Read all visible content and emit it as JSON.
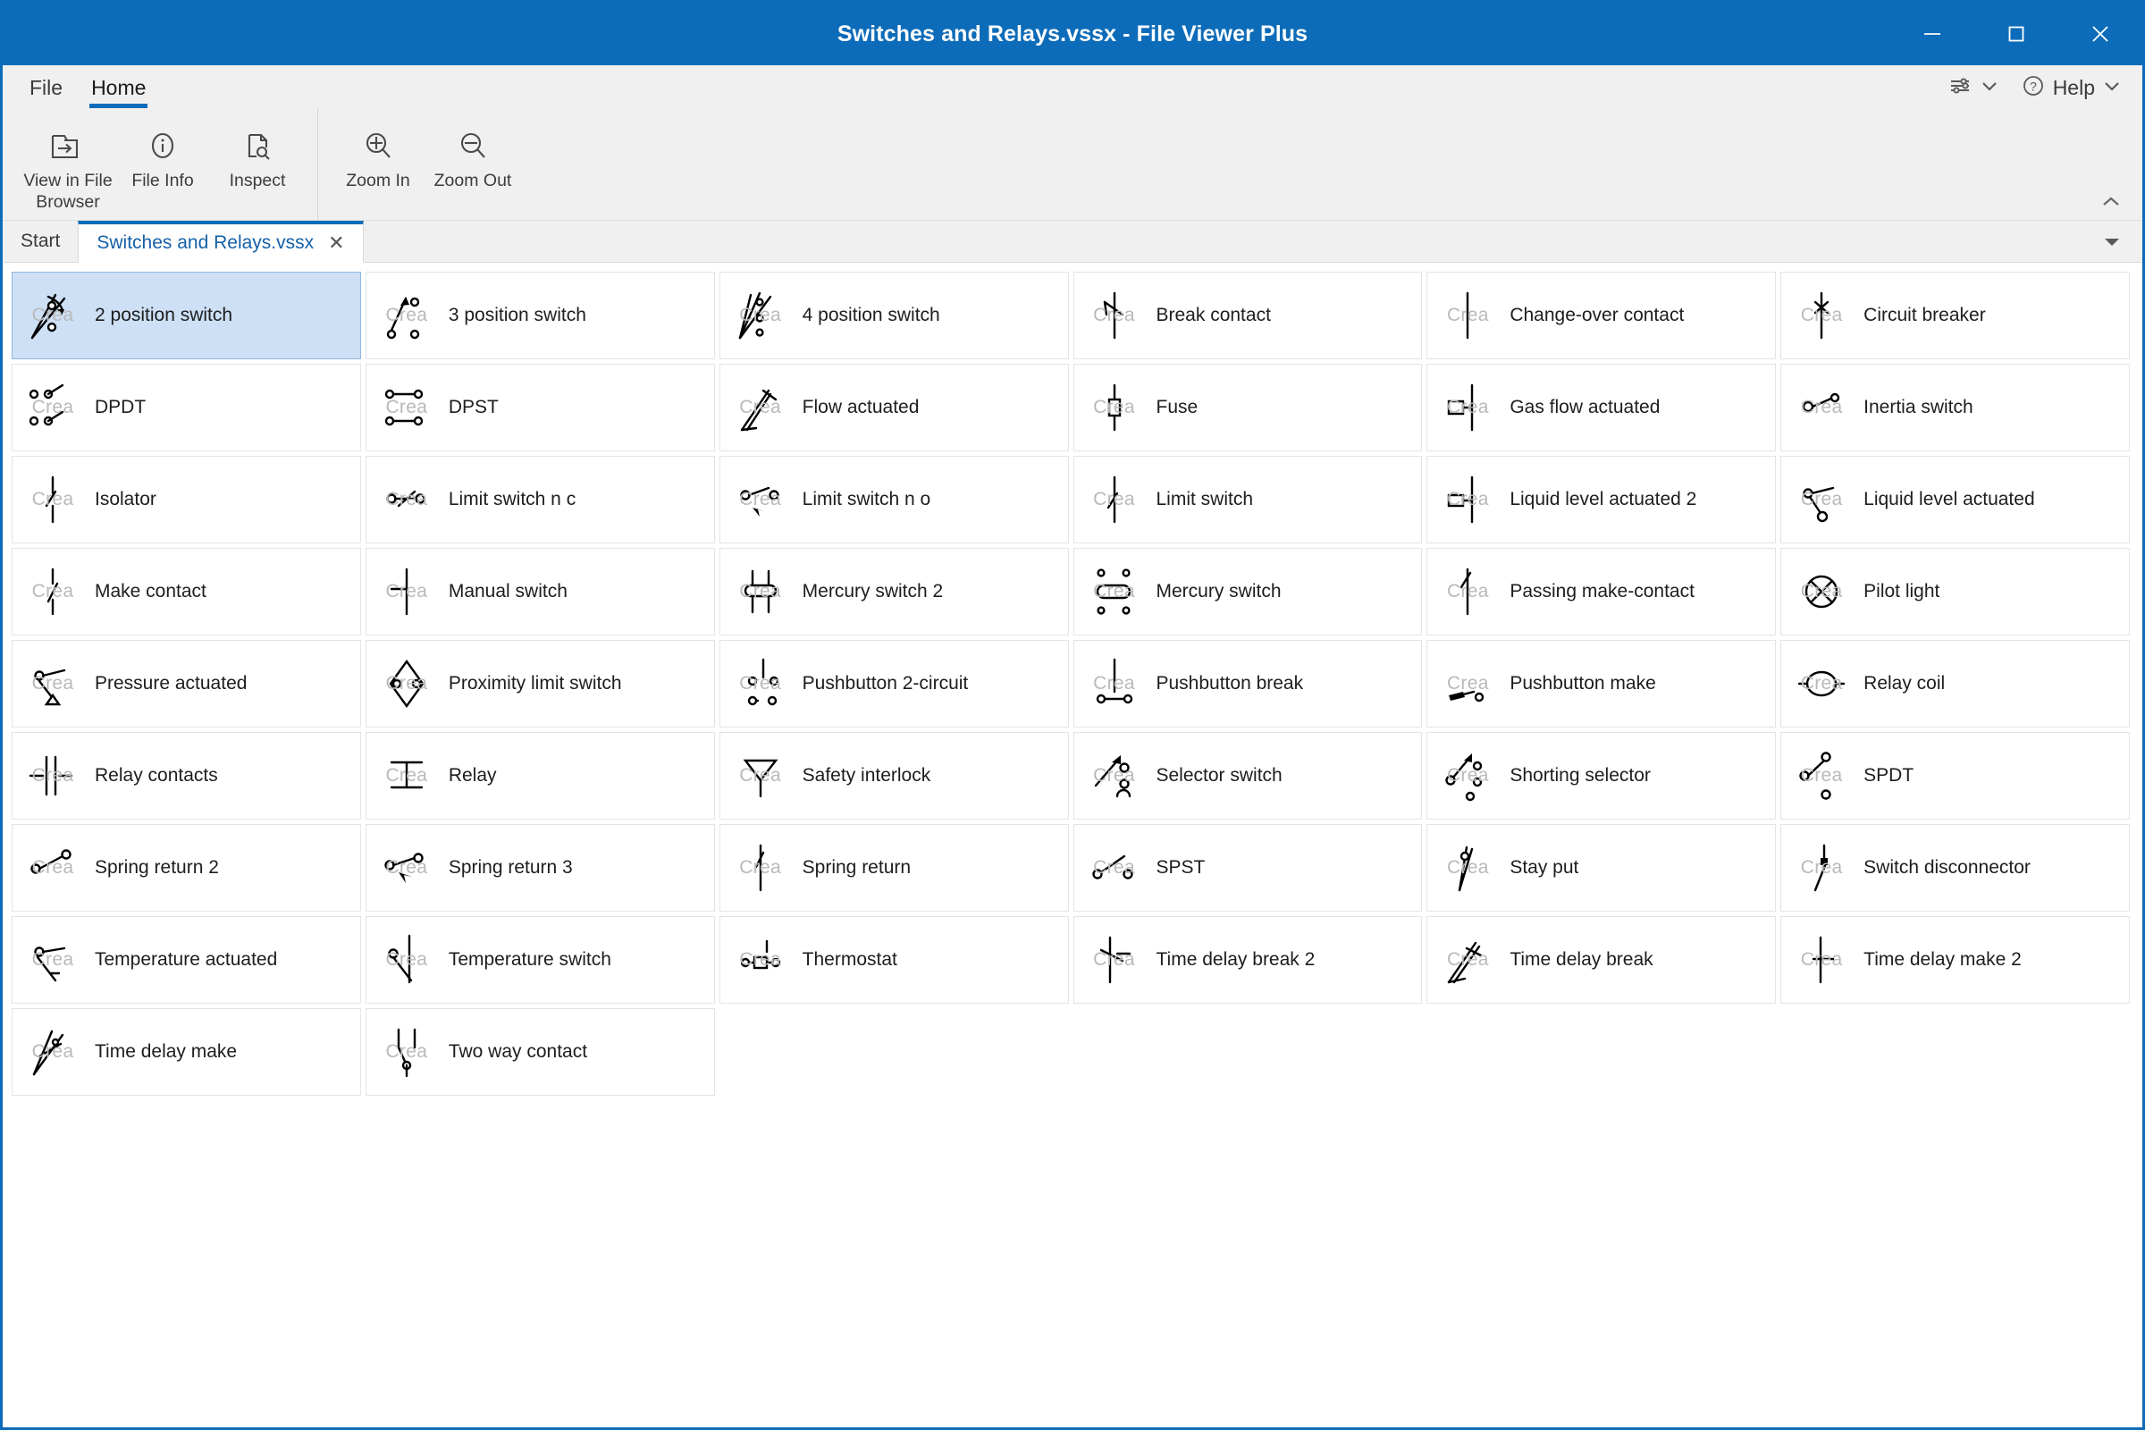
{
  "window": {
    "title": "Switches and Relays.vssx - File Viewer Plus",
    "minimize_label": "minimize",
    "maximize_label": "maximize",
    "close_label": "close",
    "accent_color": "#0d6cb9",
    "titlebar_color": "#0d6cb9",
    "selection_color": "#cde0f5"
  },
  "ribbon": {
    "tabs": [
      {
        "label": "File",
        "active": false
      },
      {
        "label": "Home",
        "active": true
      }
    ],
    "groups": [
      {
        "buttons": [
          {
            "label": "View in File Browser",
            "icon": "open-folder-arrow-icon"
          },
          {
            "label": "File Info",
            "icon": "info-circle-icon"
          },
          {
            "label": "Inspect",
            "icon": "document-magnifier-icon"
          }
        ]
      },
      {
        "buttons": [
          {
            "label": "Zoom In",
            "icon": "zoom-in-icon"
          },
          {
            "label": "Zoom Out",
            "icon": "zoom-out-icon"
          }
        ]
      }
    ],
    "quick_settings": {
      "icon": "sliders-icon",
      "chevron": "chevron-down-icon"
    },
    "help": {
      "label": "Help",
      "icon": "question-circle-icon",
      "chevron": "chevron-down-icon"
    },
    "collapse": {
      "icon": "chevron-up-icon"
    }
  },
  "doc_tabs": {
    "tabs": [
      {
        "label": "Start",
        "active": false,
        "closable": false
      },
      {
        "label": "Switches and Relays.vssx",
        "active": true,
        "closable": true,
        "close_glyph": "✕"
      }
    ],
    "overflow": {
      "icon": "chevron-down-icon"
    }
  },
  "stencil": {
    "watermark": "Crea",
    "items": [
      {
        "label": "2 position switch",
        "shape": "two-position-switch",
        "selected": true
      },
      {
        "label": "3 position switch",
        "shape": "three-position-switch",
        "selected": false
      },
      {
        "label": "4 position switch",
        "shape": "four-position-switch",
        "selected": false
      },
      {
        "label": "Break contact",
        "shape": "break-contact",
        "selected": false
      },
      {
        "label": "Change-over contact",
        "shape": "change-over-contact",
        "selected": false
      },
      {
        "label": "Circuit breaker",
        "shape": "circuit-breaker",
        "selected": false
      },
      {
        "label": "DPDT",
        "shape": "dpdt",
        "selected": false
      },
      {
        "label": "DPST",
        "shape": "dpst",
        "selected": false
      },
      {
        "label": "Flow actuated",
        "shape": "flow-actuated",
        "selected": false
      },
      {
        "label": "Fuse",
        "shape": "fuse",
        "selected": false
      },
      {
        "label": "Gas flow actuated",
        "shape": "gas-flow-actuated",
        "selected": false
      },
      {
        "label": "Inertia switch",
        "shape": "inertia-switch",
        "selected": false
      },
      {
        "label": "Isolator",
        "shape": "isolator",
        "selected": false
      },
      {
        "label": "Limit switch n c",
        "shape": "limit-switch-nc",
        "selected": false
      },
      {
        "label": "Limit switch n o",
        "shape": "limit-switch-no",
        "selected": false
      },
      {
        "label": "Limit switch",
        "shape": "limit-switch",
        "selected": false
      },
      {
        "label": "Liquid level actuated 2",
        "shape": "liquid-level-actuated-2",
        "selected": false
      },
      {
        "label": "Liquid level actuated",
        "shape": "liquid-level-actuated",
        "selected": false
      },
      {
        "label": "Make contact",
        "shape": "make-contact",
        "selected": false
      },
      {
        "label": "Manual switch",
        "shape": "manual-switch",
        "selected": false
      },
      {
        "label": "Mercury switch 2",
        "shape": "mercury-switch-2",
        "selected": false
      },
      {
        "label": "Mercury switch",
        "shape": "mercury-switch",
        "selected": false
      },
      {
        "label": "Passing make-contact",
        "shape": "passing-make-contact",
        "selected": false
      },
      {
        "label": "Pilot light",
        "shape": "pilot-light",
        "selected": false
      },
      {
        "label": "Pressure actuated",
        "shape": "pressure-actuated",
        "selected": false
      },
      {
        "label": "Proximity limit switch",
        "shape": "proximity-limit-switch",
        "selected": false
      },
      {
        "label": "Pushbutton 2-circuit",
        "shape": "pushbutton-2-circuit",
        "selected": false
      },
      {
        "label": "Pushbutton break",
        "shape": "pushbutton-break",
        "selected": false
      },
      {
        "label": "Pushbutton make",
        "shape": "pushbutton-make",
        "selected": false
      },
      {
        "label": "Relay coil",
        "shape": "relay-coil",
        "selected": false
      },
      {
        "label": "Relay contacts",
        "shape": "relay-contacts",
        "selected": false
      },
      {
        "label": "Relay",
        "shape": "relay",
        "selected": false
      },
      {
        "label": "Safety interlock",
        "shape": "safety-interlock",
        "selected": false
      },
      {
        "label": "Selector switch",
        "shape": "selector-switch",
        "selected": false
      },
      {
        "label": "Shorting selector",
        "shape": "shorting-selector",
        "selected": false
      },
      {
        "label": "SPDT",
        "shape": "spdt",
        "selected": false
      },
      {
        "label": "Spring return 2",
        "shape": "spring-return-2",
        "selected": false
      },
      {
        "label": "Spring return 3",
        "shape": "spring-return-3",
        "selected": false
      },
      {
        "label": "Spring return",
        "shape": "spring-return",
        "selected": false
      },
      {
        "label": "SPST",
        "shape": "spst",
        "selected": false
      },
      {
        "label": "Stay put",
        "shape": "stay-put",
        "selected": false
      },
      {
        "label": "Switch disconnector",
        "shape": "switch-disconnector",
        "selected": false
      },
      {
        "label": "Temperature actuated",
        "shape": "temperature-actuated",
        "selected": false
      },
      {
        "label": "Temperature switch",
        "shape": "temperature-switch",
        "selected": false
      },
      {
        "label": "Thermostat",
        "shape": "thermostat",
        "selected": false
      },
      {
        "label": "Time delay break 2",
        "shape": "time-delay-break-2",
        "selected": false
      },
      {
        "label": "Time delay break",
        "shape": "time-delay-break",
        "selected": false
      },
      {
        "label": "Time delay make 2",
        "shape": "time-delay-make-2",
        "selected": false
      },
      {
        "label": "Time delay make",
        "shape": "time-delay-make",
        "selected": false
      },
      {
        "label": "Two way contact",
        "shape": "two-way-contact",
        "selected": false
      }
    ]
  }
}
